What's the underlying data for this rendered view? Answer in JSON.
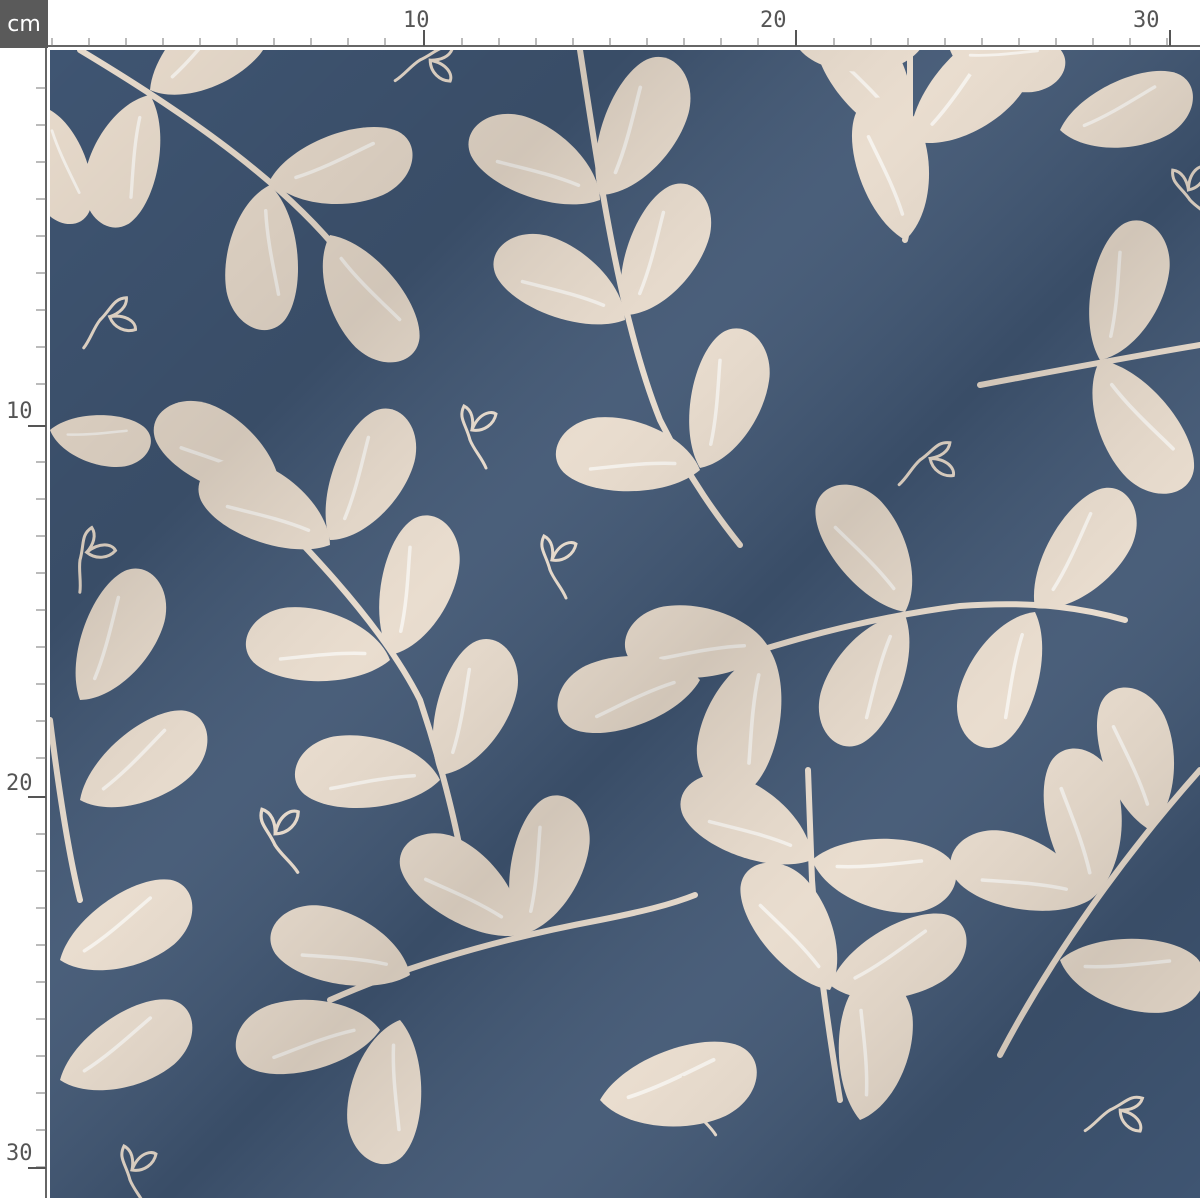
{
  "ruler": {
    "unit": "cm",
    "top_labels": [
      "10",
      "20",
      "30"
    ],
    "left_labels": [
      "10",
      "20",
      "30"
    ]
  },
  "fabric": {
    "pattern": "leafy sprigs",
    "background_color": "#3f5572",
    "leaf_color": "#e8dbcc",
    "vein_color": "#f6f2ec",
    "stem_color": "#e8dbcc"
  }
}
